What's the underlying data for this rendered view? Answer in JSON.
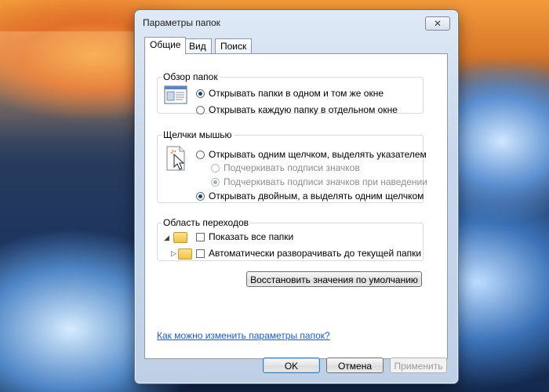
{
  "dialog": {
    "title": "Параметры папок",
    "close_glyph": "✕"
  },
  "tabs": [
    {
      "label": "Общие",
      "active": true
    },
    {
      "label": "Вид",
      "active": false
    },
    {
      "label": "Поиск",
      "active": false
    }
  ],
  "browse_folders": {
    "legend": "Обзор папок",
    "options": [
      {
        "label": "Открывать папки в одном и том же окне",
        "checked": true
      },
      {
        "label": "Открывать каждую папку в отдельном окне",
        "checked": false
      }
    ]
  },
  "mouse_clicks": {
    "legend": "Щелчки мышью",
    "options": [
      {
        "label": "Открывать одним щелчком, выделять указателем",
        "checked": false,
        "disabled": false
      },
      {
        "label": "Подчеркивать подписи значков",
        "checked": false,
        "disabled": true
      },
      {
        "label": "Подчеркивать подписи значков при наведении",
        "checked": true,
        "disabled": true
      },
      {
        "label": "Открывать двойным, а выделять одним щелчком",
        "checked": true,
        "disabled": false
      }
    ]
  },
  "navigation_pane": {
    "legend": "Область переходов",
    "options": [
      {
        "label": "Показать все папки",
        "checked": false
      },
      {
        "label": "Автоматически разворачивать до текущей папки",
        "checked": false
      }
    ]
  },
  "restore_defaults_label": "Восстановить значения по умолчанию",
  "help_link": "Как можно изменить параметры папок?",
  "buttons": {
    "ok": "OK",
    "cancel": "Отмена",
    "apply": "Применить"
  }
}
